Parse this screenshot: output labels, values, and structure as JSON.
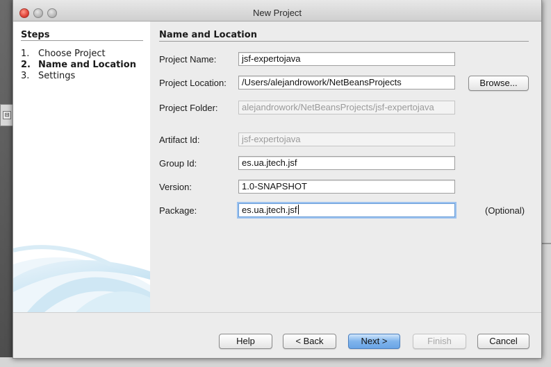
{
  "window": {
    "title": "New Project"
  },
  "steps": {
    "header": "Steps",
    "items": [
      {
        "number": "1.",
        "label": "Choose Project",
        "current": false
      },
      {
        "number": "2.",
        "label": "Name and Location",
        "current": true
      },
      {
        "number": "3.",
        "label": "Settings",
        "current": false
      }
    ]
  },
  "main": {
    "section_title": "Name and Location",
    "project_name": {
      "label": "Project Name:",
      "value": "jsf-expertojava"
    },
    "project_location": {
      "label": "Project Location:",
      "value": "/Users/alejandrowork/NetBeansProjects"
    },
    "browse_button": "Browse...",
    "project_folder": {
      "label": "Project Folder:",
      "value": "alejandrowork/NetBeansProjects/jsf-expertojava"
    },
    "artifact_id": {
      "label": "Artifact Id:",
      "value": "jsf-expertojava"
    },
    "group_id": {
      "label": "Group Id:",
      "value": "es.ua.jtech.jsf"
    },
    "version": {
      "label": "Version:",
      "value": "1.0-SNAPSHOT"
    },
    "package": {
      "label": "Package:",
      "value": "es.ua.jtech.jsf",
      "note": "(Optional)"
    }
  },
  "buttons": {
    "help": "Help",
    "back": "< Back",
    "next": "Next >",
    "finish": "Finish",
    "cancel": "Cancel"
  },
  "colors": {
    "default_button": "#7fb4ec",
    "focus_ring": "#9cc2ef",
    "close_light": "#e0443a"
  }
}
